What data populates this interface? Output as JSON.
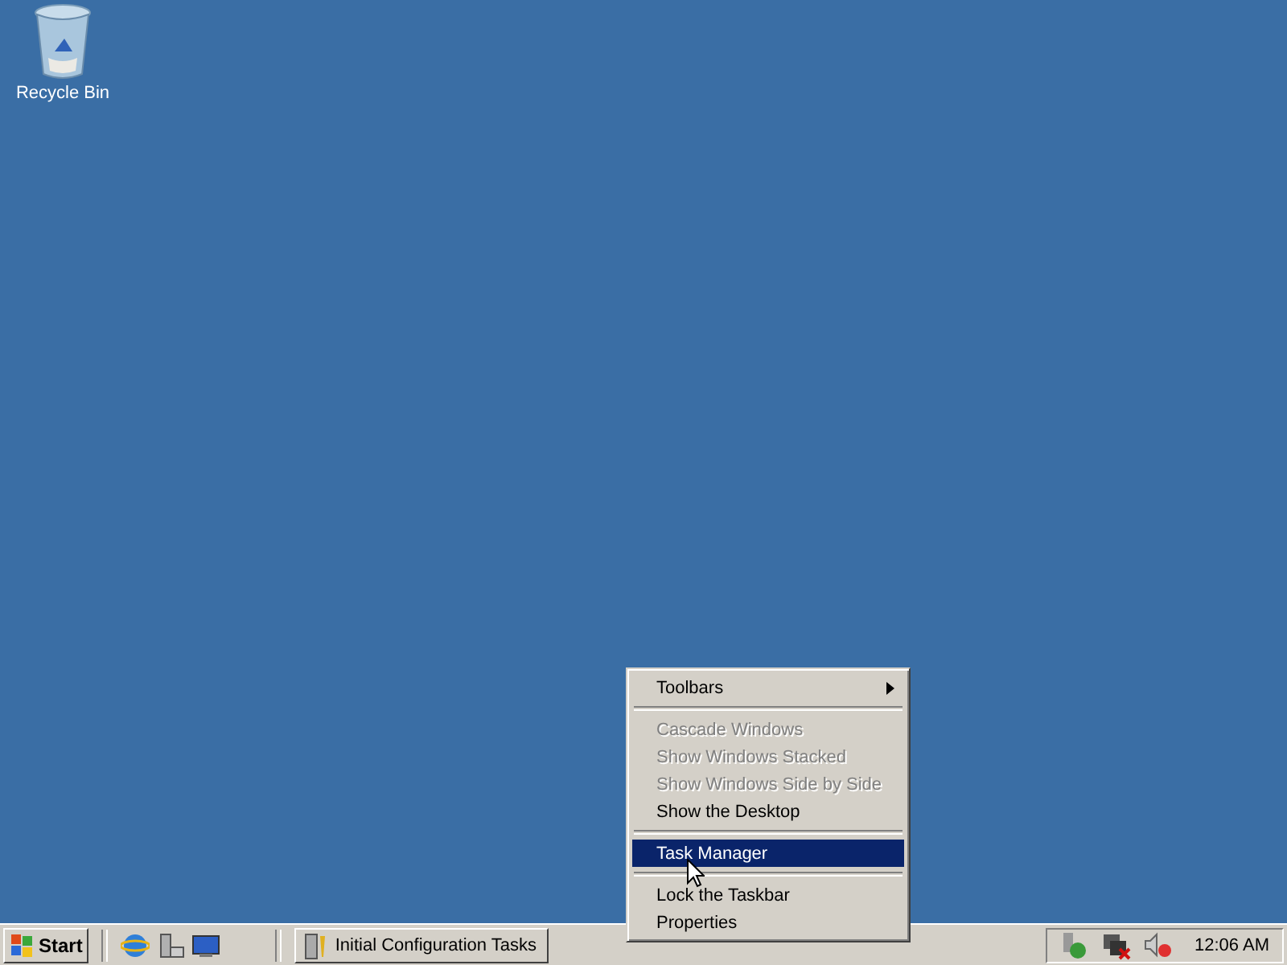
{
  "desktop_icons": [
    {
      "label": "Recycle Bin"
    }
  ],
  "context_menu": {
    "items": [
      {
        "kind": "item",
        "label": "Toolbars",
        "disabled": false,
        "selected": false,
        "submenu": true
      },
      {
        "kind": "separator"
      },
      {
        "kind": "item",
        "label": "Cascade Windows",
        "disabled": true,
        "selected": false,
        "submenu": false
      },
      {
        "kind": "item",
        "label": "Show Windows Stacked",
        "disabled": true,
        "selected": false,
        "submenu": false
      },
      {
        "kind": "item",
        "label": "Show Windows Side by Side",
        "disabled": true,
        "selected": false,
        "submenu": false
      },
      {
        "kind": "item",
        "label": "Show the Desktop",
        "disabled": false,
        "selected": false,
        "submenu": false
      },
      {
        "kind": "separator"
      },
      {
        "kind": "item",
        "label": "Task Manager",
        "disabled": false,
        "selected": true,
        "submenu": false
      },
      {
        "kind": "separator"
      },
      {
        "kind": "item",
        "label": "Lock the Taskbar",
        "disabled": false,
        "selected": false,
        "submenu": false
      },
      {
        "kind": "item",
        "label": "Properties",
        "disabled": false,
        "selected": false,
        "submenu": false
      }
    ]
  },
  "taskbar": {
    "start_button": "Start",
    "tasks": [
      {
        "label": "Initial Configuration Tasks",
        "selected": false
      }
    ],
    "clock": "12:06 AM"
  }
}
